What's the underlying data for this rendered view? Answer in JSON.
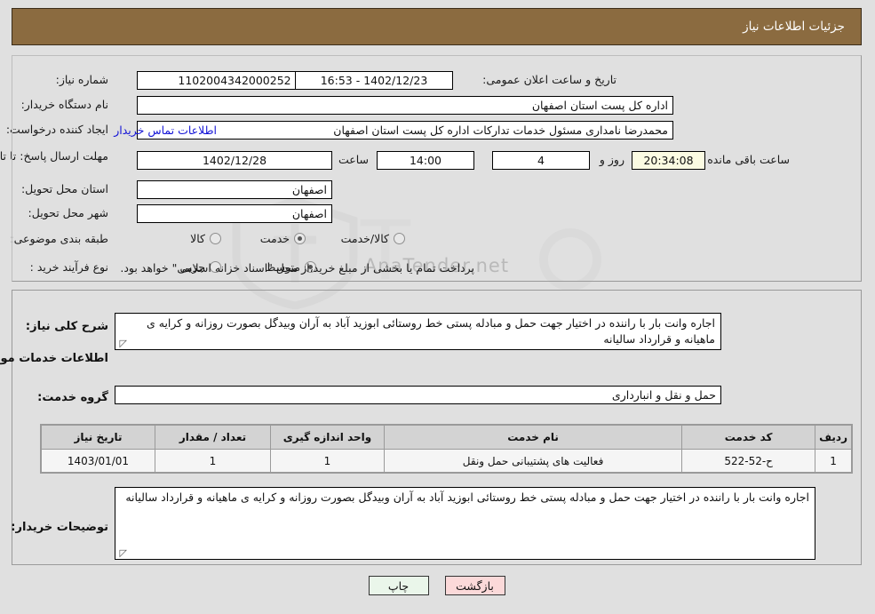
{
  "window": {
    "title": "جزئیات اطلاعات نیاز",
    "watermark": "AnaTender.net"
  },
  "theme": {
    "header_bg": "#8b6b40",
    "page_bg": "#e0e0e0",
    "link_color": "#1414d6",
    "timer_bg": "#fbfbe2",
    "print_btn_bg": "#eaf6ea",
    "back_btn_bg": "#fbd9d9"
  },
  "top_form": {
    "need_number_label": "شماره نیاز:",
    "need_number_value": "1102004342000252",
    "announce_datetime_label": "تاریخ و ساعت اعلان عمومی:",
    "announce_datetime_value": "1402/12/23 - 16:53",
    "buyer_org_label": "نام دستگاه خریدار:",
    "buyer_org_value": "اداره کل پست استان اصفهان",
    "requester_label": "ایجاد کننده درخواست:",
    "requester_value": "محمدرضا نامداری مسئول خدمات تدارکات اداره کل پست استان اصفهان",
    "contact_link": "اطلاعات تماس خریدار",
    "deadline_label": "مهلت ارسال پاسخ: تا تاریخ:",
    "deadline_date": "1402/12/28",
    "hour_label": "ساعت",
    "deadline_time": "14:00",
    "days_value": "4",
    "days_label": "روز و",
    "countdown_value": "20:34:08",
    "remaining_label": "ساعت باقی مانده",
    "province_label": "استان محل تحویل:",
    "province_value": "اصفهان",
    "city_label": "شهر محل تحویل:",
    "city_value": "اصفهان",
    "category_label": "طبقه بندی موضوعی:",
    "category_options": [
      {
        "label": "کالا",
        "selected": false
      },
      {
        "label": "خدمت",
        "selected": true
      },
      {
        "label": "کالا/خدمت",
        "selected": false
      }
    ],
    "process_label": "نوع فرآیند خرید :",
    "process_options": [
      {
        "label": "جزیی",
        "selected": false
      },
      {
        "label": "متوسط",
        "selected": true
      }
    ],
    "payment_note": "پرداخت تمام یا بخشی از مبلغ خرید،از محل \"اسناد خزانه اسلامی\" خواهد بود."
  },
  "mid_form": {
    "general_desc_label": "شرح کلی نیاز:",
    "general_desc_value": "اجاره وانت بار با راننده در اختیار جهت حمل و مبادله پستی خط روستائی ابوزید آباد به آران وبیدگل بصورت روزانه و کرایه ی ماهیانه و قرارداد سالیانه",
    "services_heading": "اطلاعات خدمات مورد نیاز",
    "service_group_label": "گروه خدمت:",
    "service_group_value": "حمل و نقل و انبارداری",
    "buyer_notes_label": "توضیحات خریدار:",
    "buyer_notes_value": "اجاره وانت بار با راننده در اختیار جهت حمل و مبادله پستی خط روستائی ابوزید آباد به آران وبیدگل بصورت روزانه و کرایه ی ماهیانه و قرارداد سالیانه"
  },
  "table": {
    "columns": [
      "ردیف",
      "کد خدمت",
      "نام خدمت",
      "واحد اندازه گیری",
      "تعداد / مقدار",
      "تاریخ نیاز"
    ],
    "rows": [
      {
        "index": "1",
        "code": "ح-52-522",
        "name": "فعالیت های پشتیبانی حمل ونقل",
        "unit": "1",
        "quantity": "1",
        "need_date": "1403/01/01"
      }
    ]
  },
  "buttons": {
    "print": "چاپ",
    "back": "بازگشت"
  }
}
